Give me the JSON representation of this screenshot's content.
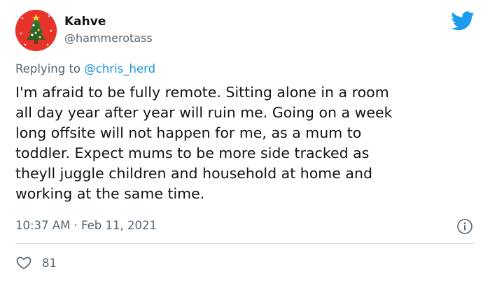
{
  "user": {
    "display_name": "Kahve",
    "handle": "@hammerotass"
  },
  "reply": {
    "prefix": "Replying to ",
    "mention": "@chris_herd"
  },
  "tweet": {
    "lines": [
      "I'm afraid to be fully remote. Sitting alone in a room",
      "all day year after year will ruin me. Going on a week",
      "long offsite will not happen for me, as a mum to",
      "toddler. Expect mums to be more side tracked as",
      "theyll juggle children and household at home and",
      "working at the same time."
    ]
  },
  "meta": {
    "timestamp": "10:37 AM · Feb 11, 2021"
  },
  "stats": {
    "likes": "81"
  },
  "icons": {
    "brand": "twitter-bird-icon",
    "info": "info-icon",
    "like": "heart-icon",
    "avatar": "christmas-tree-avatar"
  },
  "colors": {
    "brand": "#1d9bf0",
    "link": "#1b95e0",
    "secondary_text": "#536471",
    "avatar_bg": "#e8332a"
  }
}
